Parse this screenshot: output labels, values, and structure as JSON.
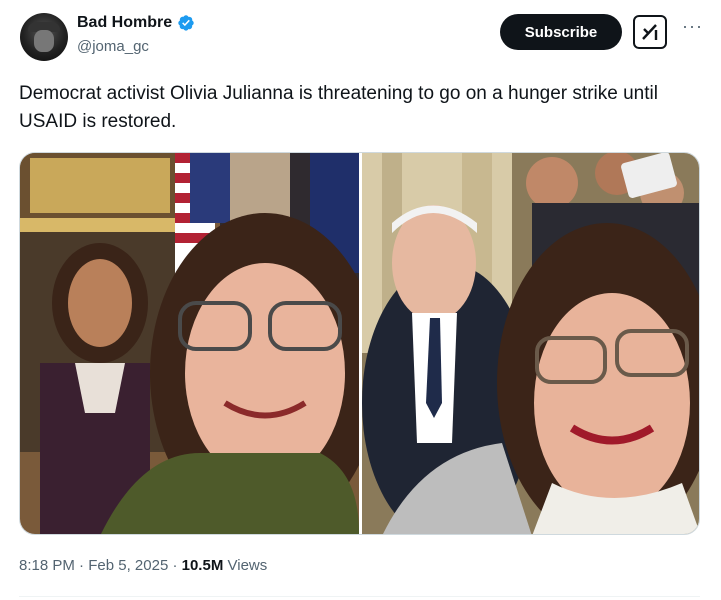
{
  "author": {
    "display_name": "Bad Hombre",
    "handle": "@joma_gc",
    "verified": true
  },
  "actions": {
    "subscribe_label": "Subscribe",
    "grok_icon": "grok-icon",
    "more_icon": "more-icon"
  },
  "tweet": {
    "text": "Democrat activist Olivia Julianna is threatening to go on a hunger strike until USAID is restored."
  },
  "media": {
    "photo_count": 2
  },
  "meta": {
    "time": "8:18 PM",
    "date": "Feb 5, 2025",
    "views_count": "10.5M",
    "views_label": "Views",
    "separator": "·"
  },
  "colors": {
    "text": "#0f1419",
    "secondary_text": "#536471",
    "verified_blue": "#1d9bf0",
    "button_bg": "#0f1419",
    "border": "#cfd9de"
  }
}
